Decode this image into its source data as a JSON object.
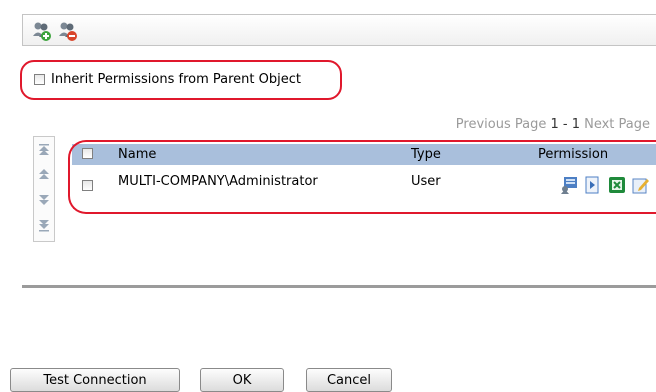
{
  "toolbar": {
    "icons": [
      "add-user-group-icon",
      "remove-user-group-icon"
    ]
  },
  "inherit": {
    "label": "Inherit Permissions from Parent Object",
    "checked": false
  },
  "pager": {
    "previous": "Previous Page",
    "current": "1 - 1",
    "next": "Next Page"
  },
  "grid": {
    "columns": [
      "Name",
      "Type",
      "Permission"
    ],
    "rows": [
      {
        "name": "MULTI-COMPANY\\Administrator",
        "type": "User",
        "permission_icons": [
          "report-viewer-icon",
          "play-icon",
          "excel-export-icon",
          "edit-icon"
        ]
      }
    ]
  },
  "nav_icons": [
    "move-top-icon",
    "move-up-icon",
    "move-down-icon",
    "move-bottom-icon"
  ],
  "buttons": {
    "test_connection": "Test Connection",
    "ok": "OK",
    "cancel": "Cancel"
  },
  "colors": {
    "highlight_oval": "#e0182c",
    "grid_header": "#a9bfdc"
  }
}
